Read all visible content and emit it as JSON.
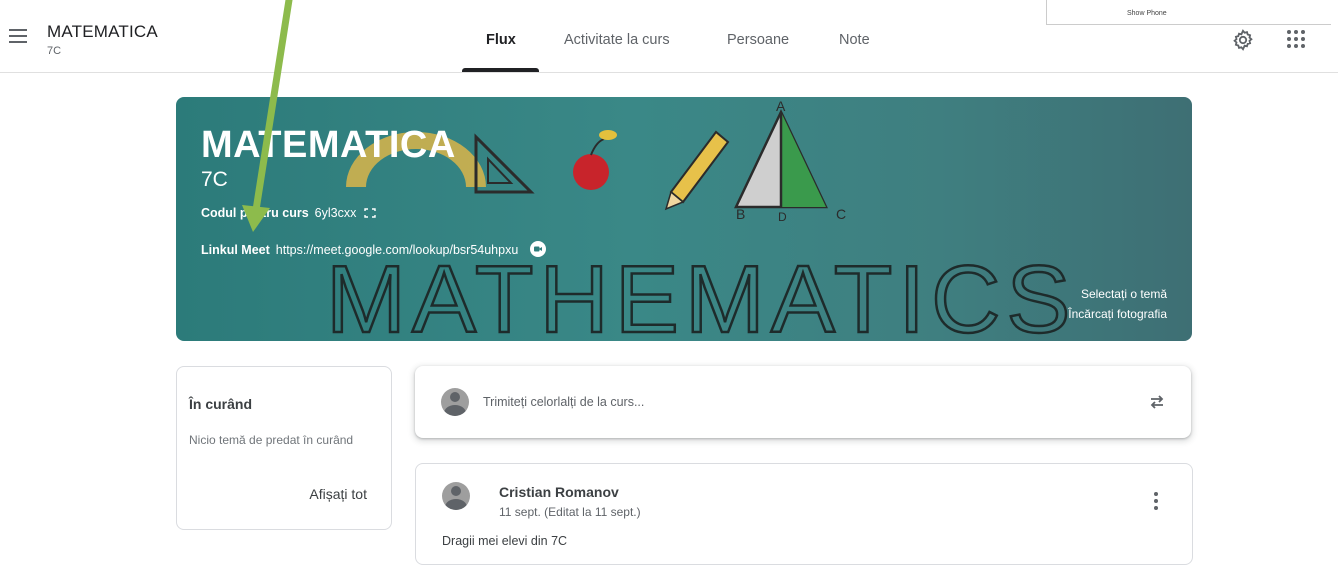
{
  "header": {
    "course_title": "MATEMATICA",
    "course_section": "7C",
    "tabs": [
      {
        "label": "Flux",
        "active": true
      },
      {
        "label": "Activitate la curs",
        "active": false
      },
      {
        "label": "Persoane",
        "active": false
      },
      {
        "label": "Note",
        "active": false
      }
    ],
    "show_phone": "Show Phone",
    "icons": [
      "menu-icon",
      "gear-icon",
      "apps-grid-icon"
    ]
  },
  "banner": {
    "title": "MATEMATICA",
    "section": "7C",
    "code_label": "Codul pentru curs",
    "code_value": "6yl3cxx",
    "meet_label": "Linkul Meet",
    "meet_url": "https://meet.google.com/lookup/bsr54uhpxu",
    "art_text": "MATHEMATICS",
    "art_letters": [
      "A",
      "B",
      "D",
      "C"
    ],
    "select_theme": "Selectați o temă",
    "upload_photo": "Încărcați fotografia",
    "color": "#2f7d7c"
  },
  "upcoming": {
    "title": "În curând",
    "empty_text": "Nicio temă de predat în curând",
    "view_all": "Afișați tot"
  },
  "compose": {
    "placeholder": "Trimiteți celorlalți de la curs..."
  },
  "post": {
    "author": "Cristian Romanov",
    "date": "11 sept. (Editat la 11 sept.)",
    "body": "Dragii mei elevi din 7C"
  },
  "annotation": {
    "arrow_color": "#8dbb4c"
  }
}
